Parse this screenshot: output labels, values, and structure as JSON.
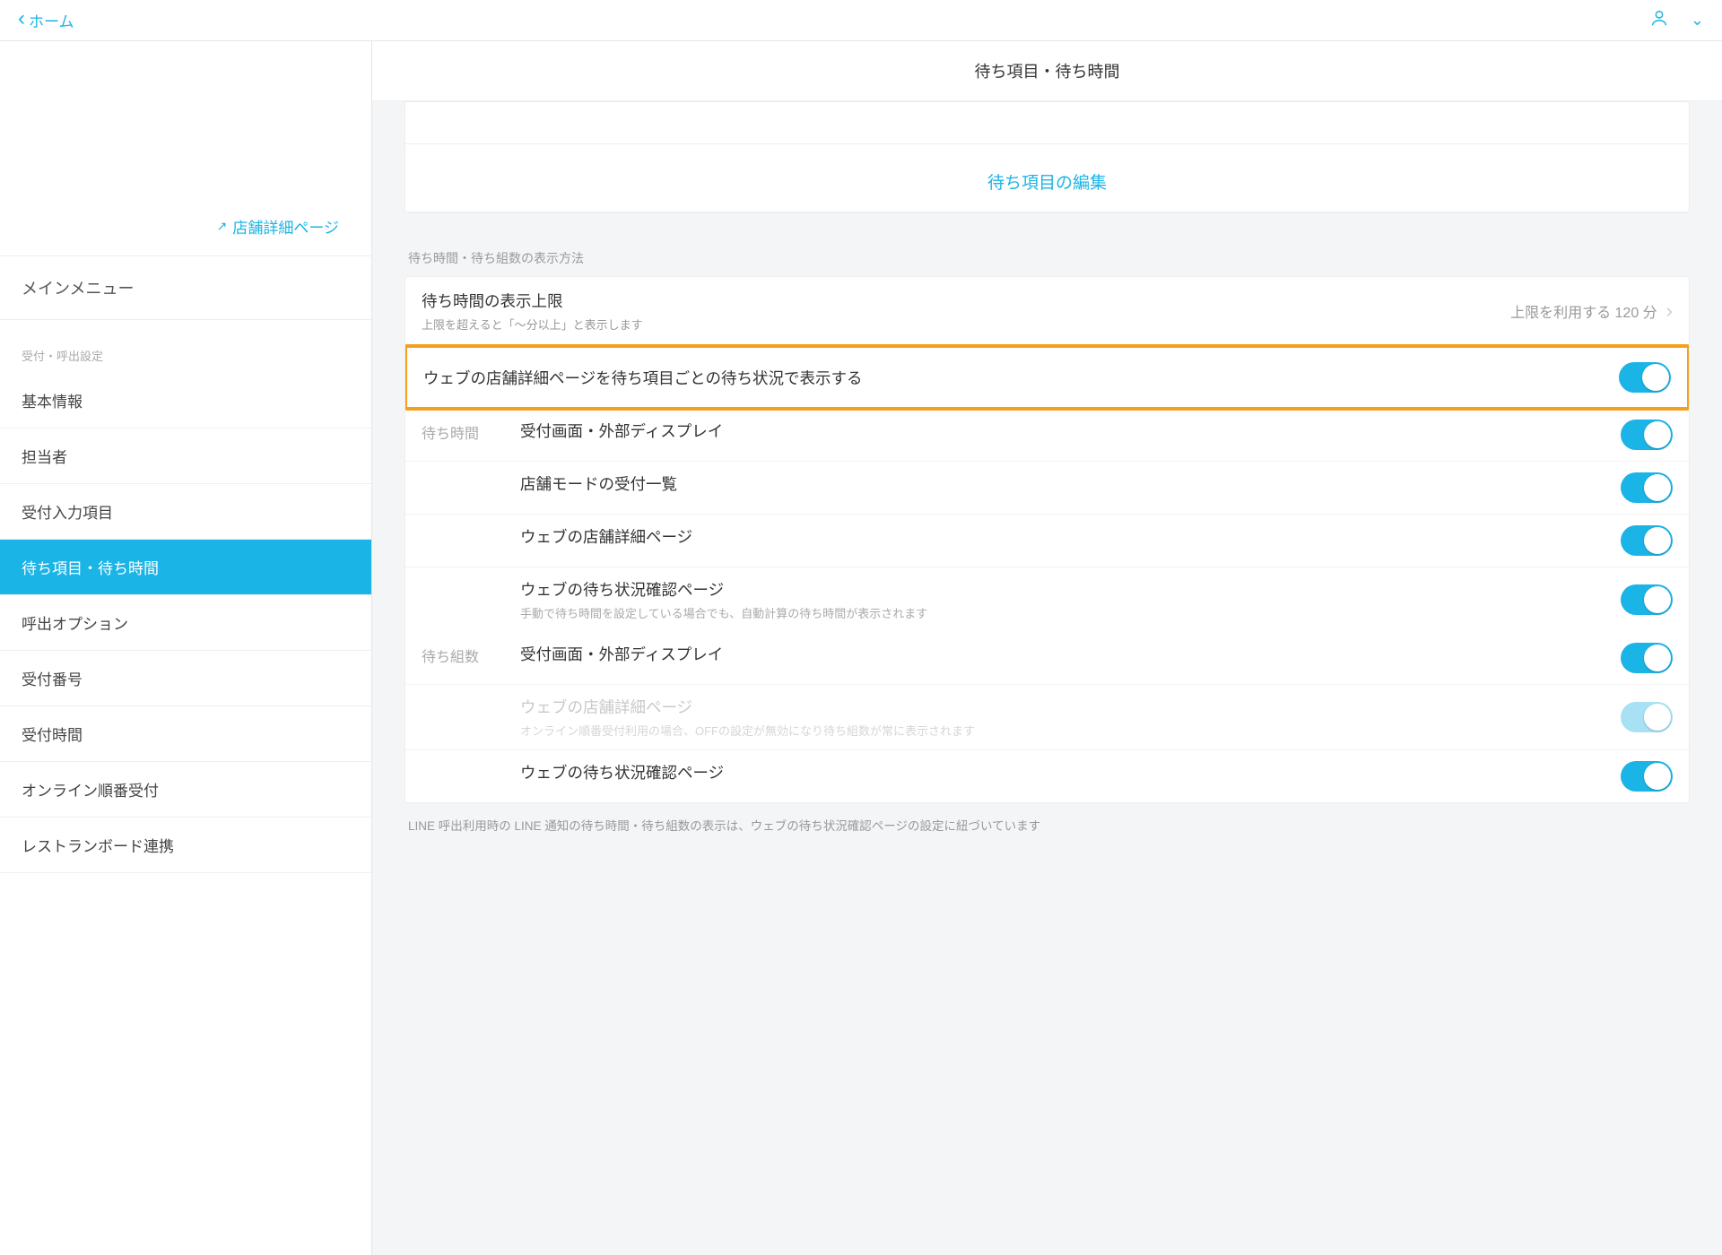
{
  "topbar": {
    "back_label": "ホーム"
  },
  "sidebar": {
    "store_link": "店舗詳細ページ",
    "main_menu_heading": "メインメニュー",
    "section_heading": "受付・呼出設定",
    "items": [
      "基本情報",
      "担当者",
      "受付入力項目",
      "待ち項目・待ち時間",
      "呼出オプション",
      "受付番号",
      "受付時間",
      "オンライン順番受付",
      "レストランボード連携"
    ],
    "active_index": 3
  },
  "main": {
    "title": "待ち項目・待ち時間",
    "edit_link": "待ち項目の編集",
    "section_label": "待ち時間・待ち組数の表示方法",
    "limit_row": {
      "label": "待ち時間の表示上限",
      "sub": "上限を超えると「〜分以上」と表示します",
      "value": "上限を利用する 120 分"
    },
    "highlight_row": {
      "label": "ウェブの店舗詳細ページを待ち項目ごとの待ち状況で表示する"
    },
    "group_a_label": "待ち時間",
    "group_a": [
      {
        "label": "受付画面・外部ディスプレイ",
        "sub": "",
        "disabled": false
      },
      {
        "label": "店舗モードの受付一覧",
        "sub": "",
        "disabled": false
      },
      {
        "label": "ウェブの店舗詳細ページ",
        "sub": "",
        "disabled": false
      },
      {
        "label": "ウェブの待ち状況確認ページ",
        "sub": "手動で待ち時間を設定している場合でも、自動計算の待ち時間が表示されます",
        "disabled": false
      }
    ],
    "group_b_label": "待ち組数",
    "group_b": [
      {
        "label": "受付画面・外部ディスプレイ",
        "sub": "",
        "disabled": false
      },
      {
        "label": "ウェブの店舗詳細ページ",
        "sub": "オンライン順番受付利用の場合、OFFの設定が無効になり待ち組数が常に表示されます",
        "disabled": true
      },
      {
        "label": "ウェブの待ち状況確認ページ",
        "sub": "",
        "disabled": false
      }
    ],
    "footnote": "LINE 呼出利用時の LINE 通知の待ち時間・待ち組数の表示は、ウェブの待ち状況確認ページの設定に紐づいています"
  }
}
